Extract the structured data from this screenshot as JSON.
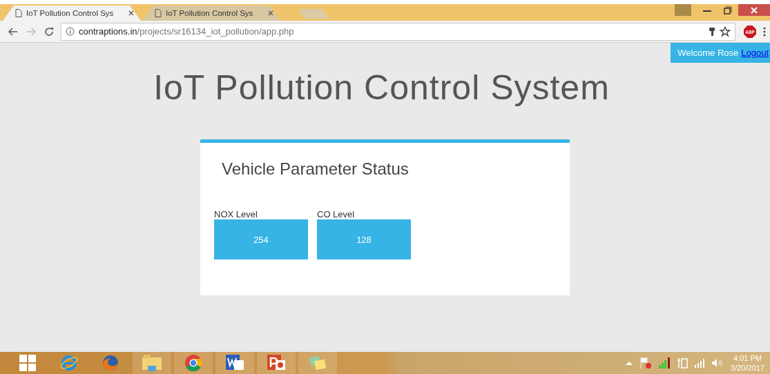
{
  "browser": {
    "tabs": [
      {
        "title": "IoT Pollution Control Sys",
        "selected": true
      },
      {
        "title": "IoT Pollution Control Sys",
        "selected": false
      }
    ],
    "address": {
      "host": "contraptions.in",
      "path": "/projects/sr16134_iot_pollution/app.php"
    },
    "extension_badge": "ABP"
  },
  "page": {
    "welcome": "Welcome Rose",
    "logout": "Logout",
    "title": "IoT Pollution Control System",
    "card": {
      "heading": "Vehicle Parameter Status",
      "tiles": [
        {
          "label": "NOX Level",
          "value": "254"
        },
        {
          "label": "CO Level",
          "value": "128"
        }
      ]
    }
  },
  "taskbar": {
    "time": "4:01 PM",
    "date": "3/20/2017"
  }
}
